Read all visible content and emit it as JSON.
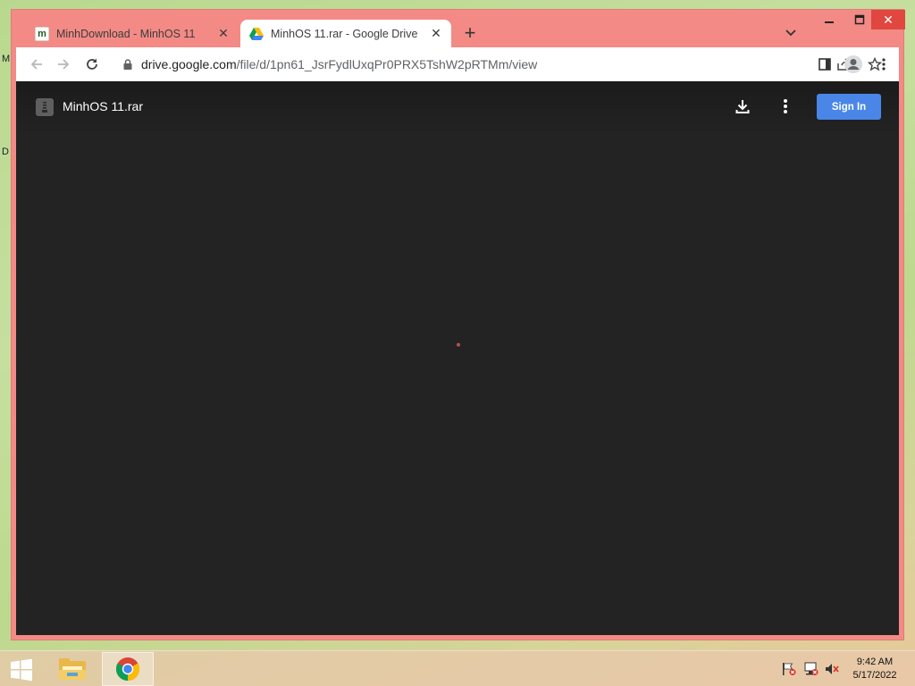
{
  "desktop": {
    "fragment_a": "M",
    "fragment_b": "D"
  },
  "browser": {
    "tabs": [
      {
        "title": "MinhDownload - MinhOS 11",
        "favicon": "minhdownload-favicon",
        "active": false
      },
      {
        "title": "MinhOS 11.rar - Google Drive",
        "favicon": "google-drive-favicon",
        "active": true
      }
    ],
    "new_tab": "+",
    "url_host": "drive.google.com",
    "url_path": "/file/d/1pn61_JsrFydlUxqPr0PRX5TshW2pRTMm/view"
  },
  "viewer": {
    "file_name": "MinhOS 11.rar",
    "sign_in_label": "Sign In"
  },
  "taskbar": {
    "time": "9:42 AM",
    "date": "5/17/2022"
  },
  "colors": {
    "window_frame": "#f38a85",
    "viewer_bg": "#232323",
    "sign_in_blue": "#4a86e8",
    "close_red": "#e0473f"
  }
}
